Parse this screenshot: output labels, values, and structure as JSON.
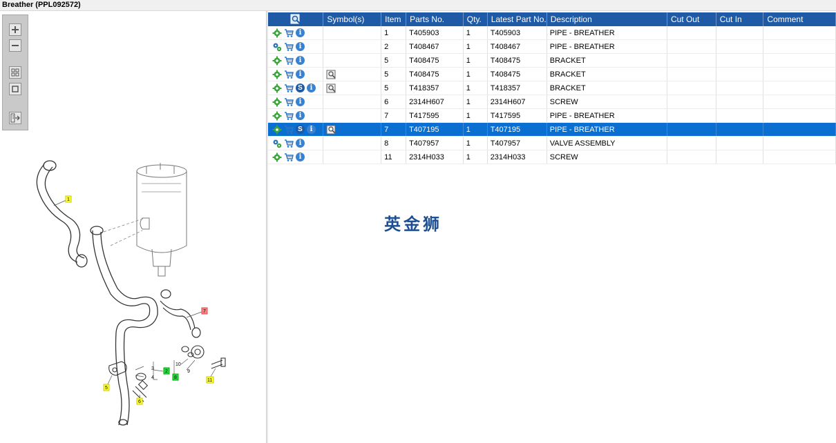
{
  "window": {
    "title": "Breather (PPL092572)"
  },
  "toolbox": {
    "buttons": [
      "zoom-in",
      "zoom-out",
      "fit-all",
      "fit-selection",
      "export"
    ]
  },
  "diagram": {
    "callouts": [
      {
        "label": "1",
        "color": "#ffff33"
      },
      {
        "label": "2",
        "color": "#22dd44"
      },
      {
        "label": "3",
        "color": "none"
      },
      {
        "label": "4",
        "color": "none"
      },
      {
        "label": "5",
        "color": "#ffff33"
      },
      {
        "label": "6",
        "color": "#ffff33"
      },
      {
        "label": "7",
        "color": "#ff8080"
      },
      {
        "label": "8",
        "color": "#22dd44"
      },
      {
        "label": "9",
        "color": "none"
      },
      {
        "label": "10",
        "color": "none"
      },
      {
        "label": "11",
        "color": "#ffff33"
      }
    ]
  },
  "table": {
    "headers": {
      "symbols": "Symbol(s)",
      "item": "Item",
      "parts_no": "Parts No.",
      "qty": "Qty.",
      "latest_part_no": "Latest Part No.",
      "description": "Description",
      "cut_out": "Cut Out",
      "cut_in": "Cut In",
      "comment": "Comment"
    },
    "rows": [
      {
        "item": "1",
        "parts_no": "T405903",
        "qty": "1",
        "latest": "T405903",
        "description": "PIPE - BREATHER",
        "cut_out": "",
        "cut_in": "",
        "comment": ""
      },
      {
        "item": "2",
        "parts_no": "T408467",
        "qty": "1",
        "latest": "T408467",
        "description": "PIPE - BREATHER",
        "cut_out": "",
        "cut_in": "",
        "comment": ""
      },
      {
        "item": "5",
        "parts_no": "T408475",
        "qty": "1",
        "latest": "T408475",
        "description": "BRACKET",
        "cut_out": "",
        "cut_in": "",
        "comment": ""
      },
      {
        "item": "5",
        "parts_no": "T408475",
        "qty": "1",
        "latest": "T408475",
        "description": "BRACKET",
        "cut_out": "",
        "cut_in": "",
        "comment": ""
      },
      {
        "item": "5",
        "parts_no": "T418357",
        "qty": "1",
        "latest": "T418357",
        "description": "BRACKET",
        "cut_out": "",
        "cut_in": "",
        "comment": ""
      },
      {
        "item": "6",
        "parts_no": "2314H607",
        "qty": "1",
        "latest": "2314H607",
        "description": "SCREW",
        "cut_out": "",
        "cut_in": "",
        "comment": ""
      },
      {
        "item": "7",
        "parts_no": "T417595",
        "qty": "1",
        "latest": "T417595",
        "description": "PIPE - BREATHER",
        "cut_out": "",
        "cut_in": "",
        "comment": ""
      },
      {
        "item": "7",
        "parts_no": "T407195",
        "qty": "1",
        "latest": "T407195",
        "description": "PIPE - BREATHER",
        "cut_out": "",
        "cut_in": "",
        "comment": ""
      },
      {
        "item": "8",
        "parts_no": "T407957",
        "qty": "1",
        "latest": "T407957",
        "description": "VALVE ASSEMBLY",
        "cut_out": "",
        "cut_in": "",
        "comment": ""
      },
      {
        "item": "11",
        "parts_no": "2314H033",
        "qty": "1",
        "latest": "2314H033",
        "description": "SCREW",
        "cut_out": "",
        "cut_in": "",
        "comment": ""
      }
    ],
    "row_icons": [
      {
        "status": "gear-green-icon",
        "s_badge": false,
        "symbol": false
      },
      {
        "status": "gears-blue-icon",
        "s_badge": false,
        "symbol": false
      },
      {
        "status": "gear-green-icon",
        "s_badge": false,
        "symbol": false
      },
      {
        "status": "gear-green-icon",
        "s_badge": false,
        "symbol": true
      },
      {
        "status": "gear-green-icon",
        "s_badge": true,
        "symbol": true
      },
      {
        "status": "gear-green-icon",
        "s_badge": false,
        "symbol": false
      },
      {
        "status": "gear-green-icon",
        "s_badge": false,
        "symbol": false
      },
      {
        "status": "gear-green-icon",
        "s_badge": true,
        "symbol": true
      },
      {
        "status": "gears-blue-icon",
        "s_badge": false,
        "symbol": false
      },
      {
        "status": "gear-green-icon",
        "s_badge": false,
        "symbol": false
      }
    ],
    "selected_row": 7,
    "s_badge_label": "S",
    "info_label": "i"
  },
  "watermark": "英金狮",
  "colors": {
    "header_bg": "#1e5aa5",
    "selected_row_bg": "#0a6fd0",
    "gear_green": "#3aa53a"
  }
}
